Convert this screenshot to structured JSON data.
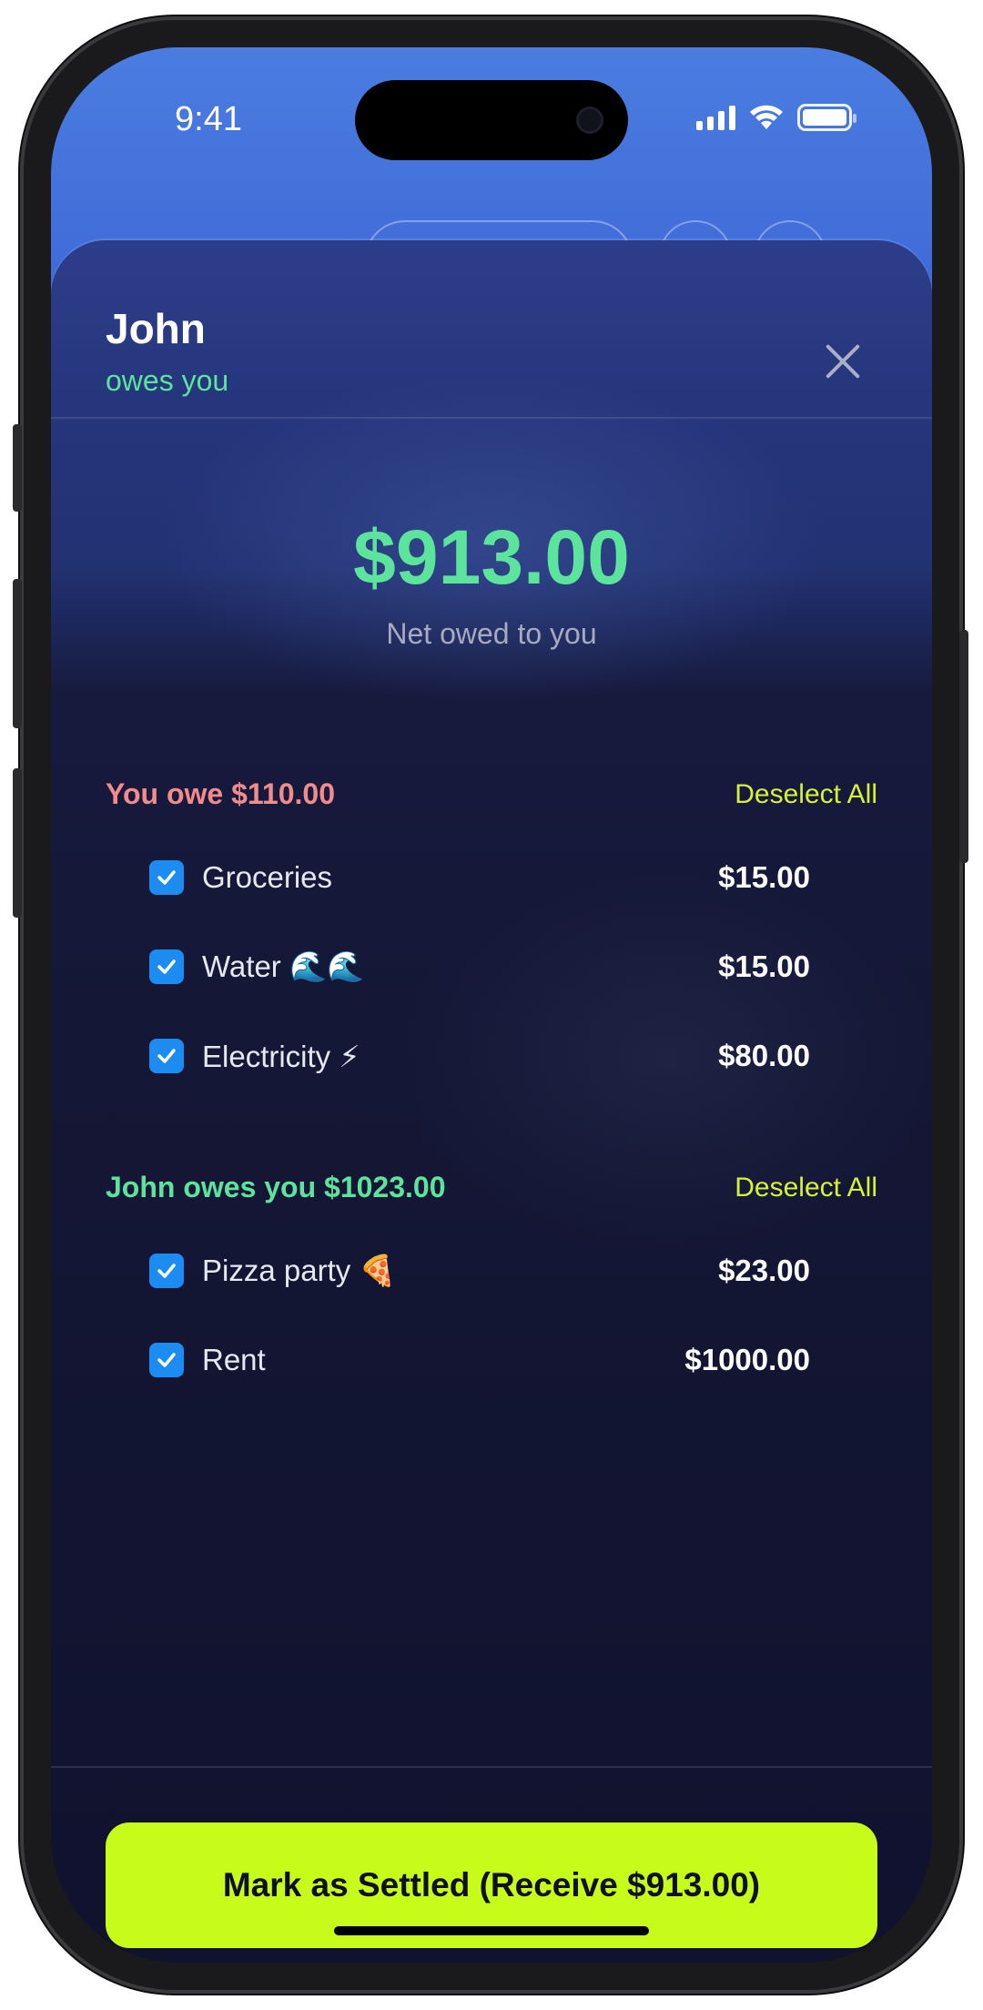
{
  "status_bar": {
    "time": "9:41"
  },
  "sheet": {
    "name": "John",
    "subtitle": "owes you",
    "close_icon": "close-icon"
  },
  "summary": {
    "net_amount": "$913.00",
    "net_label": "Net owed to you"
  },
  "sections": [
    {
      "title": "You owe $110.00",
      "title_color": "#f28b8b",
      "deselect_label": "Deselect All",
      "items": [
        {
          "label": "Groceries",
          "amount": "$15.00",
          "checked": true
        },
        {
          "label": "Water 🌊🌊",
          "amount": "$15.00",
          "checked": true
        },
        {
          "label": "Electricity ⚡",
          "amount": "$80.00",
          "checked": true
        }
      ]
    },
    {
      "title": "John owes you $1023.00",
      "title_color": "#5ce39c",
      "deselect_label": "Deselect All",
      "items": [
        {
          "label": "Pizza party 🍕",
          "amount": "$23.00",
          "checked": true
        },
        {
          "label": "Rent",
          "amount": "$1000.00",
          "checked": true
        }
      ]
    }
  ],
  "action": {
    "settle_label": "Mark as Settled (Receive $913.00)"
  },
  "colors": {
    "accent_green": "#5ce39c",
    "accent_lime": "#c6fb1a",
    "deselect": "#d6f237",
    "checkbox": "#1d8cf2",
    "owe_red": "#f28b8b"
  }
}
